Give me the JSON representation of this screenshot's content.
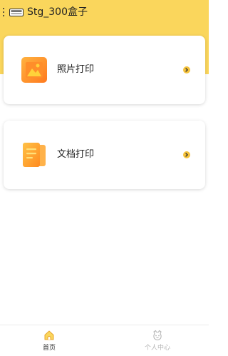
{
  "header": {
    "title": "Stg_300盒子",
    "menu_icon": "more-vertical-icon",
    "device_icon": "printer-device-icon"
  },
  "cards": [
    {
      "label": "照片打印",
      "icon": "photo-icon",
      "action_icon": "chevron-right-icon"
    },
    {
      "label": "文档打印",
      "icon": "document-icon",
      "action_icon": "chevron-right-icon"
    }
  ],
  "bottom_nav": {
    "items": [
      {
        "label": "首页",
        "icon": "home-icon",
        "active": true
      },
      {
        "label": "个人中心",
        "icon": "profile-icon",
        "active": false
      }
    ]
  },
  "colors": {
    "accent": "#FAD65C",
    "icon_orange": "#FF9A2E",
    "active_text": "#333333",
    "inactive_text": "#B5B5B5"
  }
}
